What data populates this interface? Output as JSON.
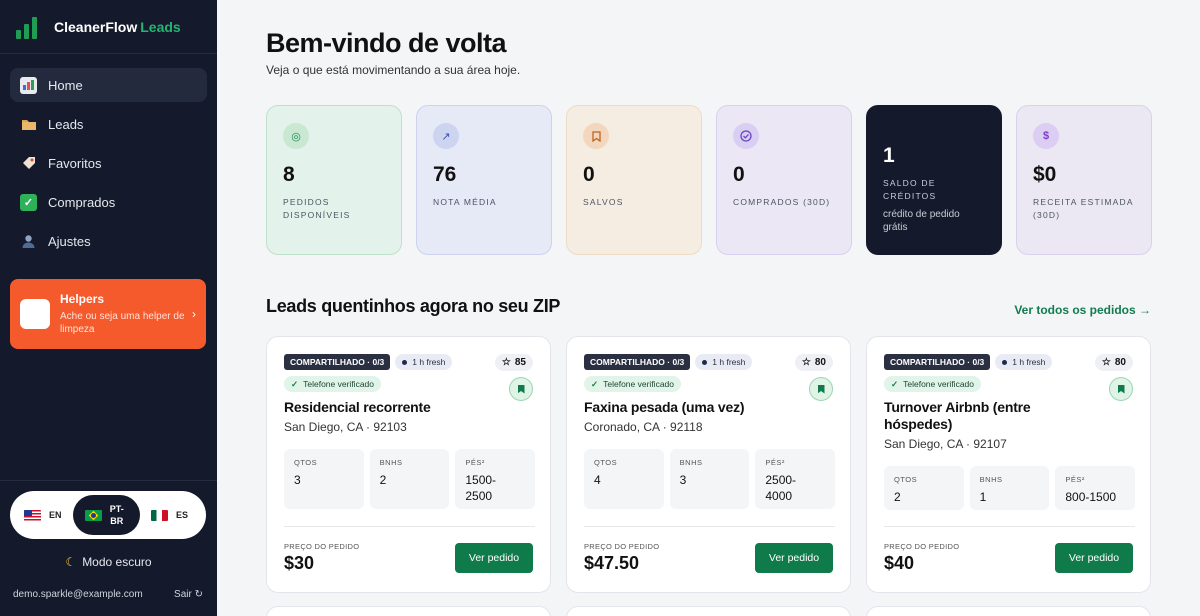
{
  "brand": {
    "name": "CleanerFlow",
    "accent": "Leads"
  },
  "nav": [
    {
      "label": "Home",
      "icon": "bar-chart-icon",
      "active": true
    },
    {
      "label": "Leads",
      "icon": "folder-icon",
      "active": false
    },
    {
      "label": "Favoritos",
      "icon": "tag-icon",
      "active": false
    },
    {
      "label": "Comprados",
      "icon": "check-box-icon",
      "active": false
    },
    {
      "label": "Ajustes",
      "icon": "user-icon",
      "active": false
    }
  ],
  "helpers": {
    "title": "Helpers",
    "subtitle": "Ache ou seja uma helper de limpeza",
    "chevron": "›"
  },
  "languages": [
    {
      "code": "EN",
      "flag": "us-flag-icon"
    },
    {
      "code": "PT-BR",
      "flag": "brazil-flag-icon",
      "active": true
    },
    {
      "code": "ES",
      "flag": "mexico-flag-icon"
    }
  ],
  "dark_mode": {
    "label": "Modo escuro",
    "icon": "moon-icon"
  },
  "user": {
    "email": "demo.sparkle@example.com",
    "logout": "Sair",
    "logout_icon": "refresh-icon"
  },
  "header": {
    "title": "Bem-vindo de volta",
    "subtitle": "Veja o que está movimentando a sua área hoje."
  },
  "stats": [
    {
      "value": "8",
      "label": "Pedidos disponíveis",
      "icon": "target-icon",
      "icon_color": "#1f8a4c"
    },
    {
      "value": "76",
      "label": "Nota média",
      "icon": "trending-up-icon",
      "icon_color": "#3b4fb5"
    },
    {
      "value": "0",
      "label": "Salvos",
      "icon": "bookmark-icon",
      "icon_color": "#c0641f"
    },
    {
      "value": "0",
      "label": "Comprados (30d)",
      "icon": "check-circle-icon",
      "icon_color": "#6a45c2"
    },
    {
      "value": "1",
      "label": "Saldo de créditos",
      "note": "crédito de pedido grátis"
    },
    {
      "value": "$0",
      "label": "Receita estimada (30d)",
      "icon": "dollar-icon",
      "icon_color": "#7a3fc4"
    }
  ],
  "section": {
    "title": "Leads quentinhos agora no seu ZIP",
    "see_all": "Ver todos os pedidos →"
  },
  "lead_labels": {
    "verified": "Telefone verificado",
    "beds": "QTOS",
    "baths": "BNHS",
    "sqft": "PÉS²",
    "price_label": "PREÇO DO PEDIDO",
    "view_button": "Ver pedido"
  },
  "leads": [
    {
      "shared": "COMPARTILHADO · 0/3",
      "fresh": "1 h fresh",
      "score": "85",
      "title": "Residencial recorrente",
      "location": "San Diego, CA · 92103",
      "beds": "3",
      "baths": "2",
      "sqft": "1500-2500",
      "price": "$30"
    },
    {
      "shared": "COMPARTILHADO · 0/3",
      "fresh": "1 h fresh",
      "score": "80",
      "title": "Faxina pesada (uma vez)",
      "location": "Coronado, CA · 92118",
      "beds": "4",
      "baths": "3",
      "sqft": "2500-4000",
      "price": "$47.50"
    },
    {
      "shared": "COMPARTILHADO · 0/3",
      "fresh": "1 h fresh",
      "score": "80",
      "title": "Turnover Airbnb (entre hóspedes)",
      "location": "San Diego, CA · 92107",
      "beds": "2",
      "baths": "1",
      "sqft": "800-1500",
      "price": "$40"
    }
  ]
}
